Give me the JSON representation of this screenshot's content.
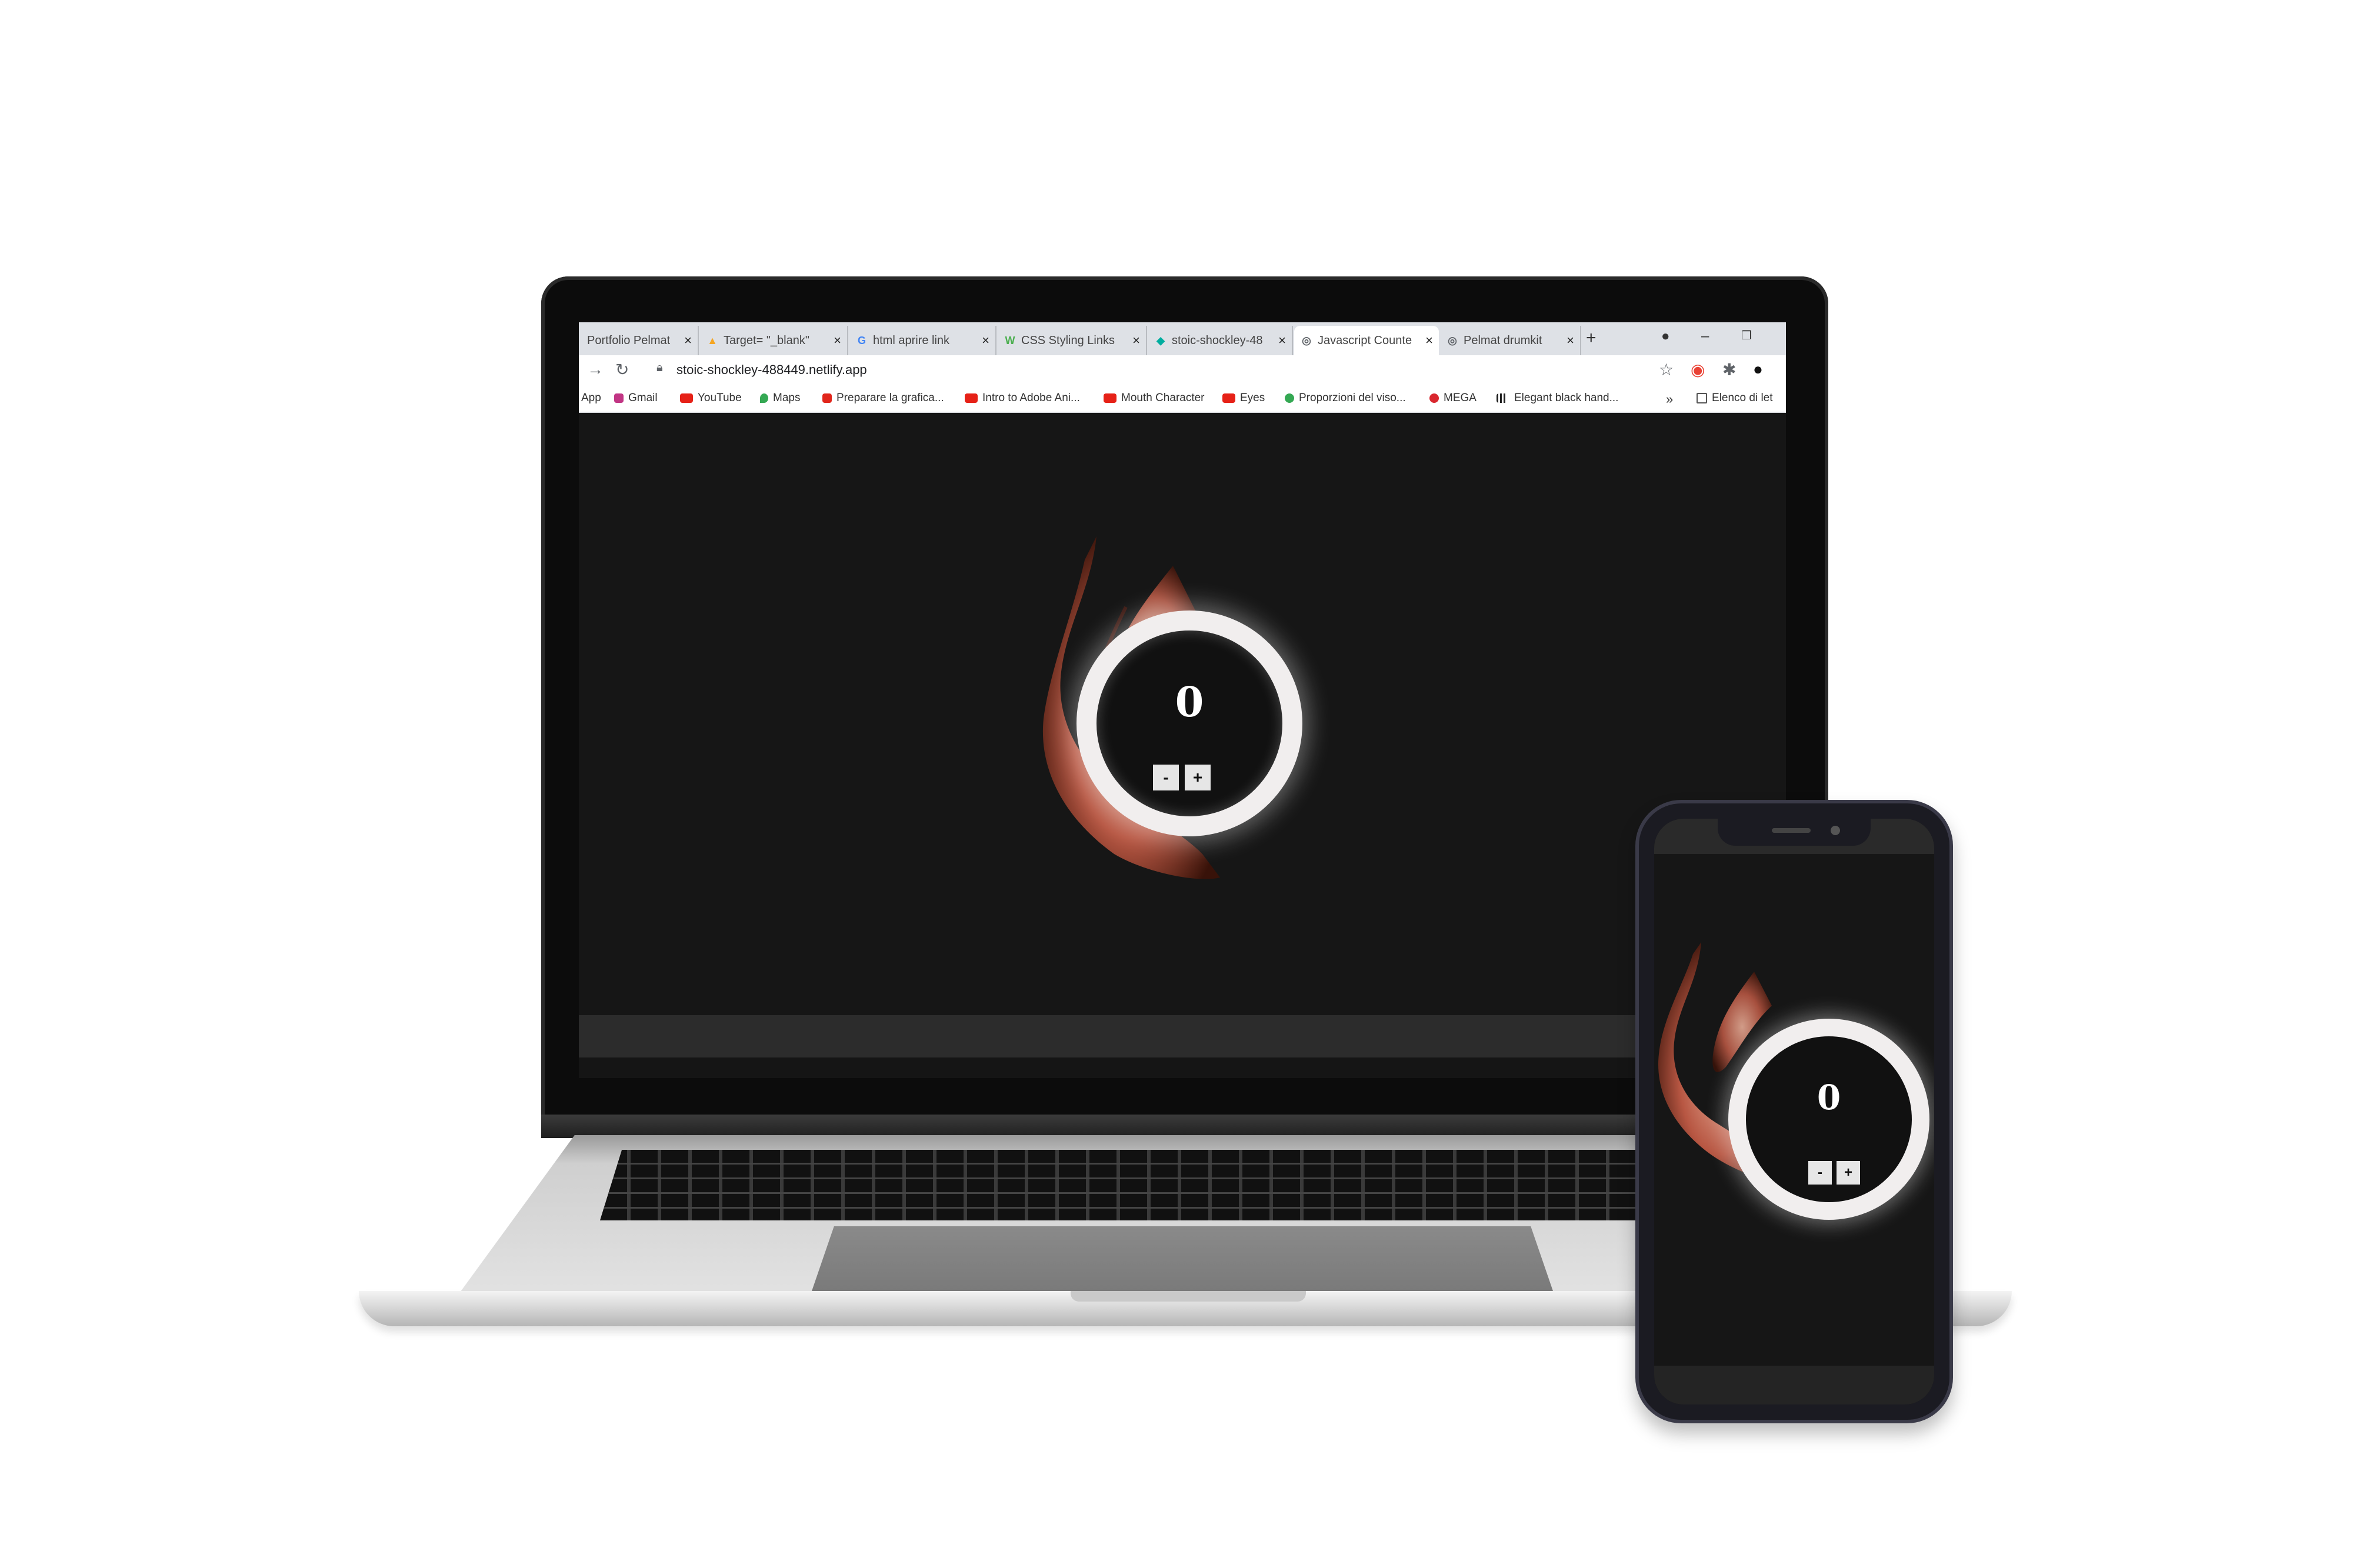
{
  "browser": {
    "tabs": [
      {
        "icon": "generic-page-icon",
        "title": "Portfolio Pelmat",
        "active": false
      },
      {
        "icon": "triangle-logo-icon",
        "title": "Target= \"_blank\"",
        "active": false
      },
      {
        "icon": "google-icon",
        "title": "html aprire link",
        "active": false
      },
      {
        "icon": "w3schools-icon",
        "title": "CSS Styling Links",
        "active": false
      },
      {
        "icon": "netlify-icon",
        "title": "stoic-shockley-48",
        "active": false
      },
      {
        "icon": "globe-icon",
        "title": "Javascript Counte",
        "active": true
      },
      {
        "icon": "globe-icon",
        "title": "Pelmat drumkit",
        "active": false
      }
    ],
    "tab_close": "×",
    "new_tab": "+",
    "window_controls": {
      "minimize": "–",
      "restore": "❐"
    },
    "url": "stoic-shockley-488449.netlify.app",
    "bookmarks": [
      {
        "icon": "apps-icon",
        "label": "App"
      },
      {
        "icon": "instagram-icon",
        "label": "Gmail"
      },
      {
        "icon": "youtube-icon",
        "label": "YouTube"
      },
      {
        "icon": "maps-pin-icon",
        "label": "Maps"
      },
      {
        "icon": "adobe-icon",
        "label": "Preparare la grafica..."
      },
      {
        "icon": "youtube-icon",
        "label": "Intro to Adobe Ani..."
      },
      {
        "icon": "youtube-icon",
        "label": "Mouth Character"
      },
      {
        "icon": "youtube-icon",
        "label": "Eyes"
      },
      {
        "icon": "green-circle-icon",
        "label": "Proporzioni del viso..."
      },
      {
        "icon": "mega-icon",
        "label": "MEGA"
      },
      {
        "icon": "signal-bars-icon",
        "label": "Elegant black hand..."
      }
    ],
    "bookmarks_more": "»",
    "reading_list": "Elenco di let"
  },
  "counter": {
    "value": "0",
    "minus_label": "-",
    "plus_label": "+"
  },
  "colors": {
    "page_background": "#161616",
    "ring": "#f1eeee",
    "button": "#e6e6e6",
    "tab_strip": "#dee1e6"
  }
}
